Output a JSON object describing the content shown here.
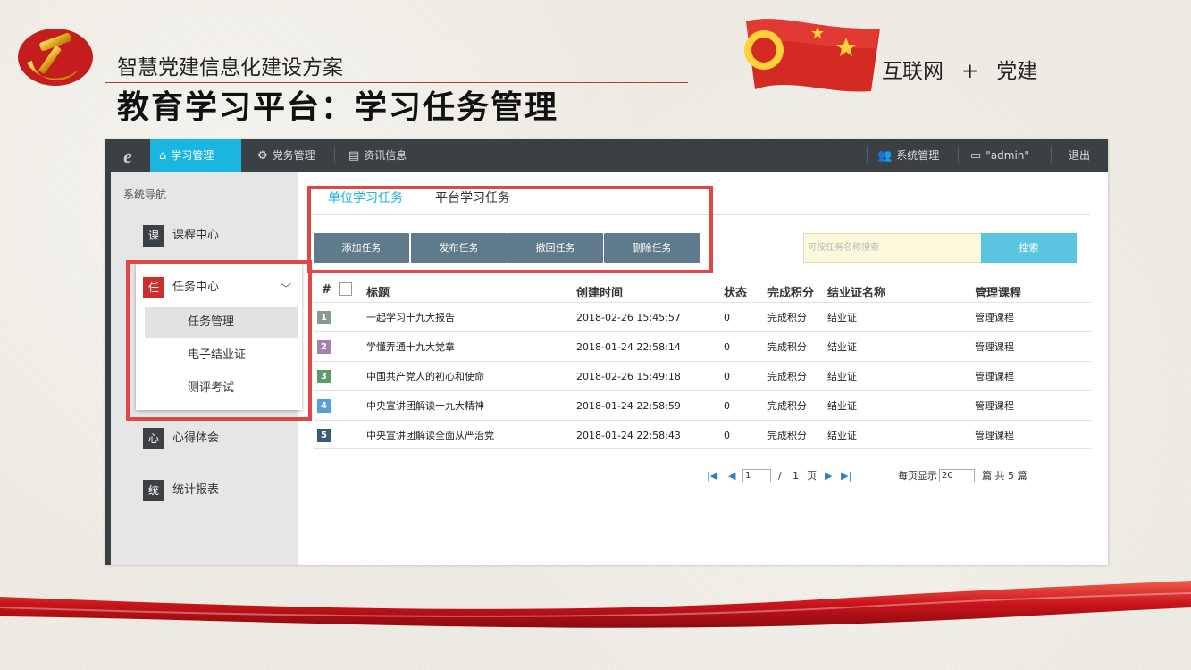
{
  "slide": {
    "subtitle": "智慧党建信息化建设方案",
    "title": "教育学习平台：学习任务管理",
    "slogan_left": "互联网",
    "slogan_plus": "+",
    "slogan_right": "党建"
  },
  "topbar": {
    "logo": "e",
    "nav": [
      {
        "label": "学习管理",
        "icon": "home-icon",
        "active": true
      },
      {
        "label": "党务管理",
        "icon": "gear-icon"
      },
      {
        "label": "资讯信息",
        "icon": "newspaper-icon"
      }
    ],
    "right": [
      {
        "label": "系统管理",
        "icon": "users-icon"
      },
      {
        "label": "\"admin\"",
        "icon": "id-card-icon"
      },
      {
        "label": "退出"
      }
    ]
  },
  "sidebar": {
    "title": "系统导航",
    "items": [
      {
        "badge": "课",
        "label": "课程中心"
      },
      {
        "badge": "任",
        "label": "任务中心",
        "expanded": true
      },
      {
        "badge": "心",
        "label": "心得体会"
      },
      {
        "badge": "统",
        "label": "统计报表"
      }
    ],
    "sub_items": [
      {
        "label": "任务管理",
        "active": true
      },
      {
        "label": "电子结业证"
      },
      {
        "label": "测评考试"
      }
    ]
  },
  "tabs": [
    {
      "label": "单位学习任务",
      "active": true
    },
    {
      "label": "平台学习任务"
    }
  ],
  "actions": [
    "添加任务",
    "发布任务",
    "撤回任务",
    "删除任务"
  ],
  "search": {
    "placeholder": "可按任务名称搜索",
    "button": "搜索"
  },
  "table": {
    "headers": [
      "#",
      "标题",
      "创建时间",
      "状态",
      "完成积分",
      "结业证名称",
      "管理课程"
    ],
    "rows": [
      {
        "num": "1",
        "color": "#8a9a8a",
        "title": "一起学习十九大报告",
        "time": "2018-02-26 15:45:57",
        "status": "0",
        "points": "完成积分",
        "cert": "结业证",
        "course": "管理课程"
      },
      {
        "num": "2",
        "color": "#a77fb0",
        "title": "学懂弄通十九大党章",
        "time": "2018-01-24 22:58:14",
        "status": "0",
        "points": "完成积分",
        "cert": "结业证",
        "course": "管理课程"
      },
      {
        "num": "3",
        "color": "#5c9a6c",
        "title": "中国共产党人的初心和使命",
        "time": "2018-02-26 15:49:18",
        "status": "0",
        "points": "完成积分",
        "cert": "结业证",
        "course": "管理课程"
      },
      {
        "num": "4",
        "color": "#5aa0d8",
        "title": "中央宣讲团解读十九大精神",
        "time": "2018-01-24 22:58:59",
        "status": "0",
        "points": "完成积分",
        "cert": "结业证",
        "course": "管理课程"
      },
      {
        "num": "5",
        "color": "#3b5a7a",
        "title": "中央宣讲团解读全面从严治党",
        "time": "2018-01-24 22:58:43",
        "status": "0",
        "points": "完成积分",
        "cert": "结业证",
        "course": "管理课程"
      }
    ]
  },
  "pager": {
    "page": "1",
    "sep": "/",
    "total_pages": "1",
    "page_unit": "页",
    "per_page_label": "每页显示",
    "per_page": "20",
    "total_label": "篇 共 5 篇"
  },
  "colors": {
    "accent": "#1ab5e0",
    "topbar": "#3b4045",
    "button": "#5f7a8c",
    "highlight": "#e04848"
  }
}
